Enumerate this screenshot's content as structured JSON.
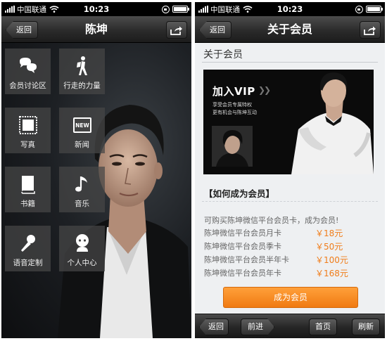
{
  "status_bar": {
    "carrier": "中国联通",
    "time": "10:23"
  },
  "left_screen": {
    "nav": {
      "back_label": "返回",
      "title": "陈坤"
    },
    "tiles": [
      {
        "label": "会员讨论区",
        "icon": "chat-bubbles-icon"
      },
      {
        "label": "行走的力量",
        "icon": "walking-person-icon"
      },
      {
        "label": "写真",
        "icon": "photo-frame-icon"
      },
      {
        "label": "新闻",
        "icon": "news-icon"
      },
      {
        "label": "书籍",
        "icon": "book-icon"
      },
      {
        "label": "音乐",
        "icon": "music-note-icon"
      },
      {
        "label": "语音定制",
        "icon": "microphone-icon"
      },
      {
        "label": "个人中心",
        "icon": "person-icon"
      }
    ]
  },
  "right_screen": {
    "nav": {
      "back_label": "返回",
      "title": "关于会员"
    },
    "page_heading": "关于会员",
    "banner": {
      "title": "加入VIP",
      "line1": "享受会员专属特权",
      "line2": "更有机会与陈坤互动"
    },
    "section_title": "【如何成为会员】",
    "intro": "可购买陈坤微信平台会员卡，成为会员!",
    "cards": [
      {
        "name": "陈坤微信平台会员月卡",
        "price": "￥18元"
      },
      {
        "name": "陈坤微信平台会员季卡",
        "price": "￥50元"
      },
      {
        "name": "陈坤微信平台会员半年卡",
        "price": "￥100元"
      },
      {
        "name": "陈坤微信平台会员年卡",
        "price": "￥168元"
      }
    ],
    "join_button": "成为会员",
    "toolbar": {
      "back": "返回",
      "forward": "前进",
      "home": "首页",
      "refresh": "刷新"
    }
  },
  "colors": {
    "accent_orange": "#f07d1a",
    "nav_dark": "#2b2b2b"
  }
}
